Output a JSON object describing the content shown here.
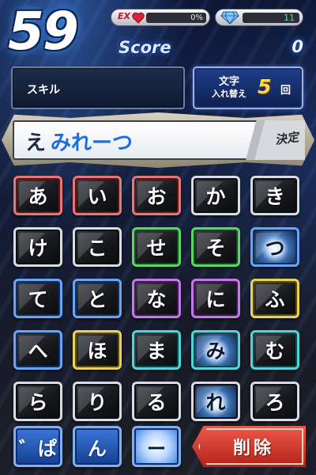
{
  "hud": {
    "timer": "59",
    "ex_label": "EX",
    "ex_percent_text": "0%",
    "ex_fraction": 0,
    "gems": "11",
    "score_label": "Score",
    "score_value": "0"
  },
  "skill": {
    "label": "スキル"
  },
  "swap": {
    "line1": "文字",
    "line2": "入れ替え",
    "count": "5",
    "unit": "回"
  },
  "word": {
    "first": "え",
    "rest": "みれーつ",
    "confirm_label": "決定"
  },
  "tiles": [
    {
      "char": "あ",
      "color": "red"
    },
    {
      "char": "い",
      "color": "red"
    },
    {
      "char": "お",
      "color": "red"
    },
    {
      "char": "か",
      "color": "white"
    },
    {
      "char": "き",
      "color": "white"
    },
    {
      "char": "け",
      "color": "white"
    },
    {
      "char": "こ",
      "color": "white"
    },
    {
      "char": "せ",
      "color": "green"
    },
    {
      "char": "そ",
      "color": "green"
    },
    {
      "char": "つ",
      "color": "blue",
      "selected": true
    },
    {
      "char": "て",
      "color": "blue"
    },
    {
      "char": "と",
      "color": "blue"
    },
    {
      "char": "な",
      "color": "purple"
    },
    {
      "char": "に",
      "color": "purple"
    },
    {
      "char": "ふ",
      "color": "yellow"
    },
    {
      "char": "へ",
      "color": "blue"
    },
    {
      "char": "ほ",
      "color": "yellow"
    },
    {
      "char": "ま",
      "color": "cyan"
    },
    {
      "char": "み",
      "color": "cyan",
      "selected": true
    },
    {
      "char": "む",
      "color": "cyan"
    },
    {
      "char": "ら",
      "color": "white"
    },
    {
      "char": "り",
      "color": "white"
    },
    {
      "char": "る",
      "color": "white"
    },
    {
      "char": "れ",
      "color": "white",
      "selected": true
    },
    {
      "char": "ろ",
      "color": "white"
    }
  ],
  "bottom": {
    "dakuten_label": "゛ぱ",
    "n_label": "ん",
    "dash_label": "ー",
    "delete_label": "削除"
  },
  "colors": {
    "accent_blue": "#1b6ee0",
    "gem_green": "#4fe38a",
    "swap_count": "#ffd84a",
    "delete_red": "#d8392c"
  }
}
